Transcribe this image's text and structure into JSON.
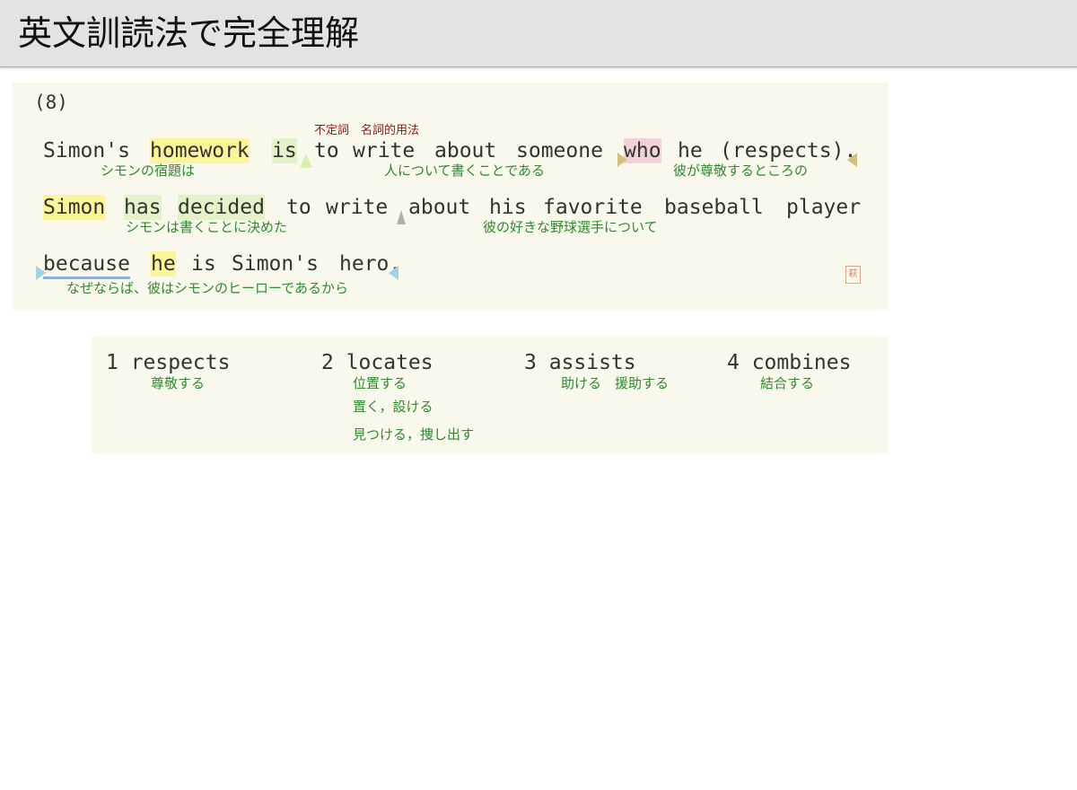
{
  "header": {
    "title": "英文訓読法で完全理解"
  },
  "question": {
    "number": "(8)",
    "grammar_note": "不定詞　名詞的用法",
    "line1": {
      "w1": "Simon's",
      "w2": "homework",
      "w3": "is",
      "w4": "to",
      "w5": "write",
      "w6": "about",
      "w7": "someone",
      "w8": "who",
      "w9": "he",
      "w10": "(respects).",
      "g1": "シモンの宿題は",
      "g2": "人について書くことである",
      "g3": "彼が尊敬するところの"
    },
    "line2": {
      "w1": "Simon",
      "w2": "has",
      "w3": "decided",
      "w4": "to",
      "w5": "write",
      "w6": "about",
      "w7": "his",
      "w8": "favorite",
      "w9": "baseball",
      "w10": "player",
      "g1": "シモンは書くことに決めた",
      "g2": "彼の好きな野球選手について"
    },
    "line3": {
      "w1": "because",
      "w2": "he",
      "w3": "is",
      "w4": "Simon's",
      "w5": "hero.",
      "g1": "なぜならば、彼はシモンのヒーローであるから"
    },
    "stamp": "萩"
  },
  "choices": [
    {
      "label": "1 respects",
      "glosses": [
        "尊敬する"
      ]
    },
    {
      "label": "2 locates",
      "glosses": [
        "位置する",
        "置く，設ける",
        "見つける，捜し出す"
      ]
    },
    {
      "label": "3 assists",
      "glosses": [
        "助ける　援助する"
      ]
    },
    {
      "label": "4 combines",
      "glosses": [
        "結合する"
      ]
    }
  ],
  "colors": {
    "header_bg": "#e2e3e5",
    "panel_bg": "#f8f8ec",
    "gloss_green": "#2f8a2f",
    "note_red": "#8b1a1a",
    "highlight_yellow": "#fbf59a",
    "highlight_green": "#e3f2c8",
    "highlight_pink": "#f2d2d8"
  }
}
